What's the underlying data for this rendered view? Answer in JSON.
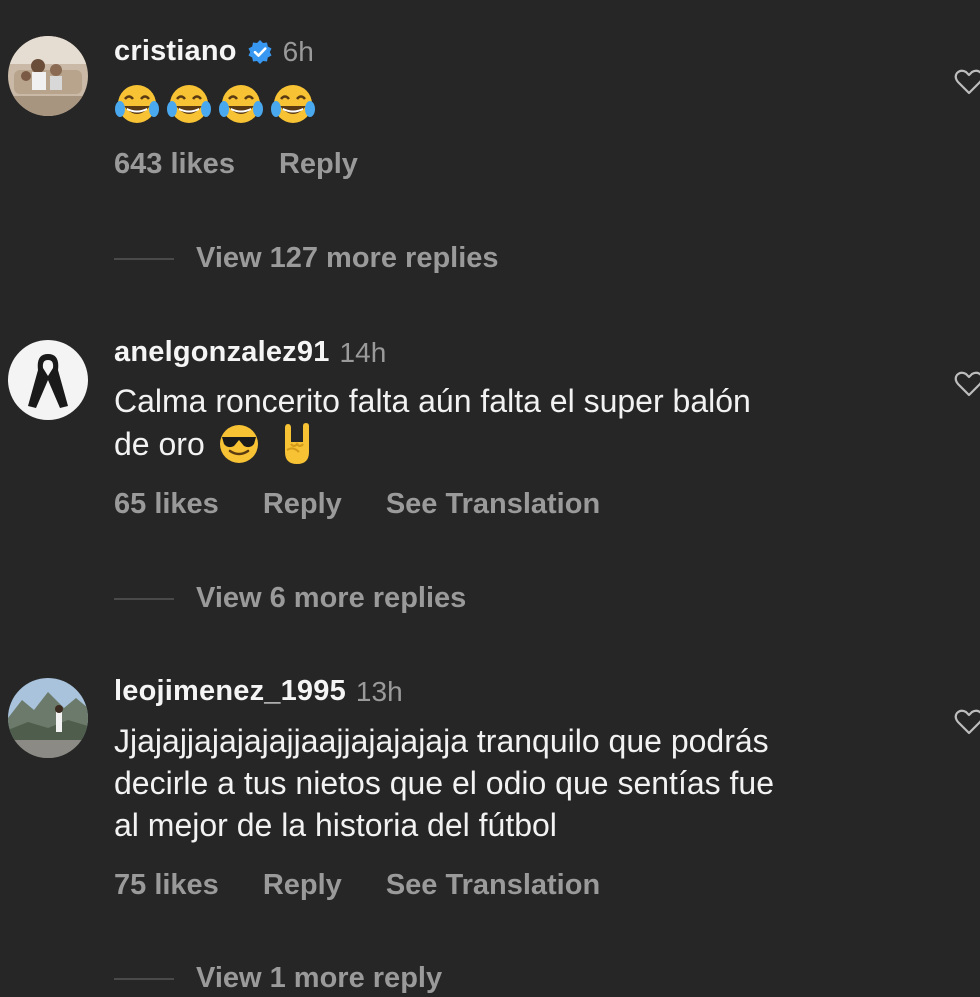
{
  "comments": [
    {
      "username": "cristiano",
      "verified": true,
      "time": "6h",
      "text": "",
      "emoji": [
        "tears-of-joy",
        "tears-of-joy",
        "tears-of-joy",
        "tears-of-joy"
      ],
      "likes": "643 likes",
      "reply": "Reply",
      "translate": "",
      "view_replies": "View 127 more replies"
    },
    {
      "username": "anelgonzalez91",
      "verified": false,
      "time": "14h",
      "text_line1": "Calma roncerito falta aún falta el super balón",
      "text_line2": "de oro",
      "emoji": [
        "smiling-face-with-sunglasses",
        "sign-of-the-horns"
      ],
      "likes": "65 likes",
      "reply": "Reply",
      "translate": "See Translation",
      "view_replies": "View 6 more replies"
    },
    {
      "username": "leojimenez_1995",
      "verified": false,
      "time": "13h",
      "text_line1": "Jjajajjajajajajjaajjajajajaja tranquilo que podrás",
      "text_line2": "decirle a tus nietos que el odio que sentías fue",
      "text_line3": "al mejor de la historia del fútbol",
      "likes": "75 likes",
      "reply": "Reply",
      "translate": "See Translation",
      "view_replies": "View 1 more reply"
    }
  ],
  "colors": {
    "background": "#262626",
    "primary_text": "#f2f2f2",
    "secondary_text": "#9a9a9a",
    "verified_blue": "#3897f0"
  }
}
